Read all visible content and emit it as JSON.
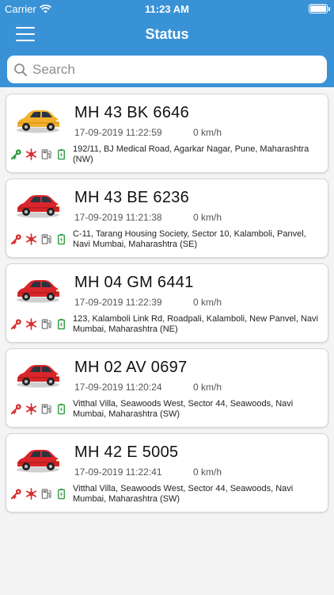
{
  "status_bar": {
    "carrier": "Carrier",
    "time": "11:23 AM"
  },
  "nav": {
    "title": "Status"
  },
  "search": {
    "placeholder": "Search",
    "value": ""
  },
  "colors": {
    "header": "#3a92d6",
    "ignition_on": "#2e9d3f",
    "ignition_off": "#d62f2f",
    "ac": "#d62f2f",
    "fuel": "#7a7a7a",
    "battery": "#2e9d3f",
    "car_moving": "#f2b02c",
    "car_stopped": "#d9262a"
  },
  "vehicles": [
    {
      "plate": "MH 43 BK 6646",
      "datetime": "17-09-2019 11:22:59",
      "speed": "0 km/h",
      "address": "192/11, BJ Medical Road, Agarkar Nagar, Pune, Maharashtra (NW)",
      "car_color": "yellow",
      "ignition": "on",
      "icons": [
        "key-icon",
        "snowflake-icon",
        "fuel-pump-icon",
        "battery-icon"
      ]
    },
    {
      "plate": "MH 43 BE 6236",
      "datetime": "17-09-2019 11:21:38",
      "speed": "0 km/h",
      "address": "C-11, Tarang Housing Society, Sector 10, Kalamboli, Panvel, Navi Mumbai, Maharashtra (SE)",
      "car_color": "red",
      "ignition": "off",
      "icons": [
        "key-icon",
        "snowflake-icon",
        "fuel-pump-icon",
        "battery-icon"
      ]
    },
    {
      "plate": "MH 04 GM 6441",
      "datetime": "17-09-2019 11:22:39",
      "speed": "0 km/h",
      "address": "123, Kalamboli Link Rd, Roadpali, Kalamboli, New Panvel, Navi Mumbai, Maharashtra (NE)",
      "car_color": "red",
      "ignition": "off",
      "icons": [
        "key-icon",
        "snowflake-icon",
        "fuel-pump-icon",
        "battery-icon"
      ]
    },
    {
      "plate": "MH 02 AV 0697",
      "datetime": "17-09-2019 11:20:24",
      "speed": "0 km/h",
      "address": "Vitthal Villa, Seawoods West, Sector 44, Seawoods, Navi Mumbai, Maharashtra (SW)",
      "car_color": "red",
      "ignition": "off",
      "icons": [
        "key-icon",
        "snowflake-icon",
        "fuel-pump-icon",
        "battery-icon"
      ]
    },
    {
      "plate": "MH 42 E 5005",
      "datetime": "17-09-2019 11:22:41",
      "speed": "0 km/h",
      "address": "Vitthal Villa, Seawoods West, Sector 44, Seawoods, Navi Mumbai, Maharashtra (SW)",
      "car_color": "red",
      "ignition": "off",
      "icons": [
        "key-icon",
        "snowflake-icon",
        "fuel-pump-icon",
        "battery-icon"
      ]
    }
  ]
}
